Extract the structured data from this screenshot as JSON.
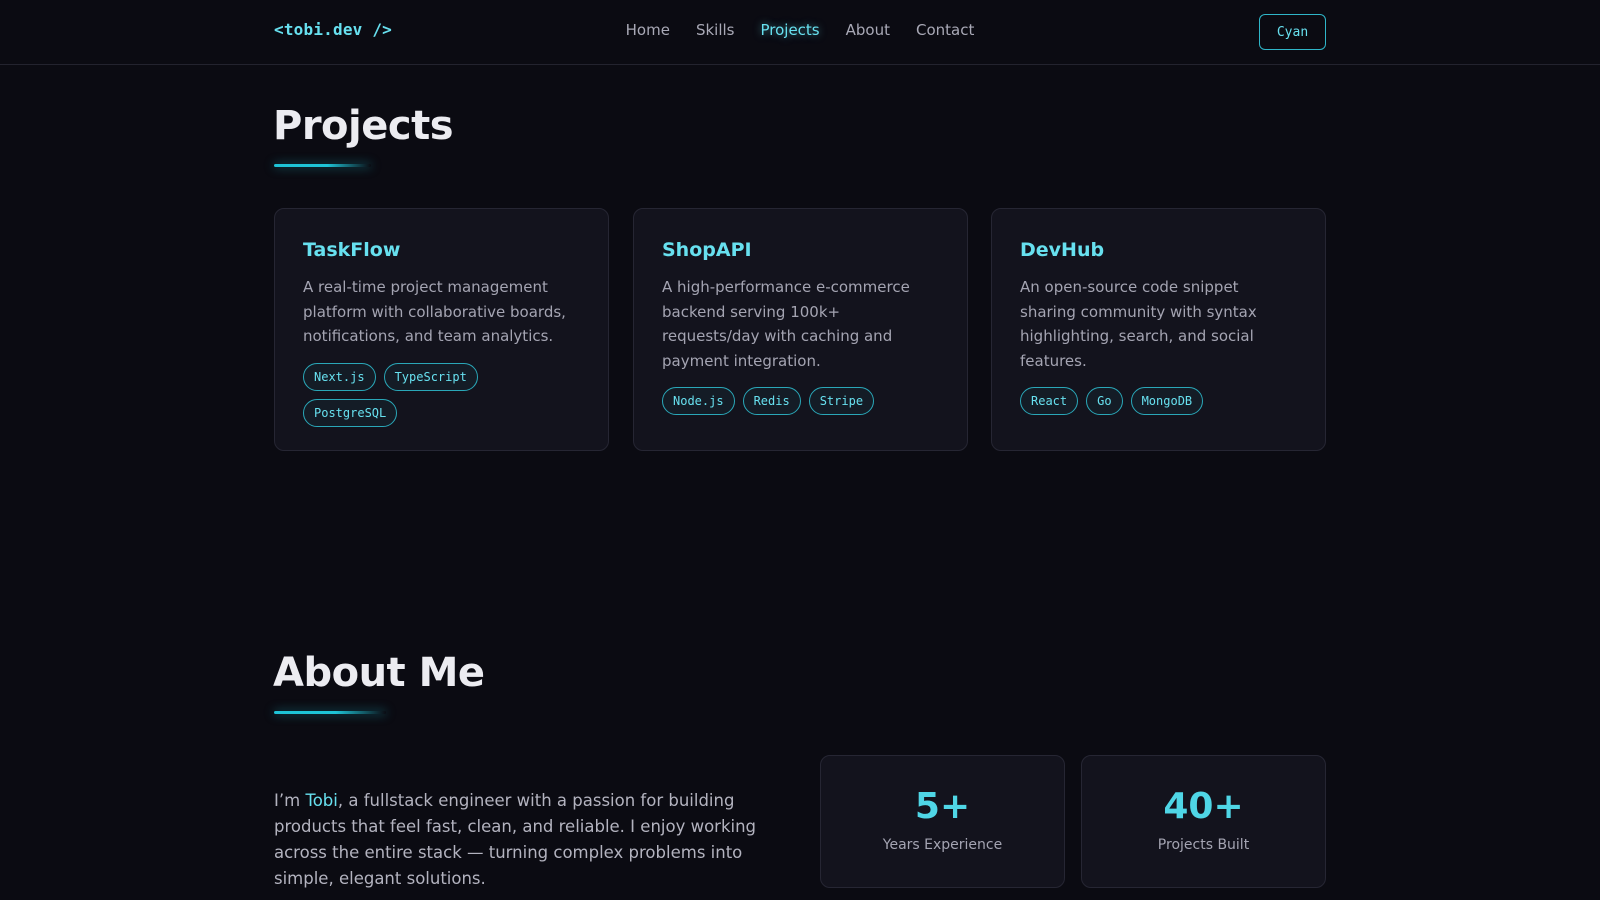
{
  "nav": {
    "logo": "<tobi.dev />",
    "links": [
      "Home",
      "Skills",
      "Projects",
      "About",
      "Contact"
    ],
    "active": "Projects",
    "theme_button": "Cyan"
  },
  "projects": {
    "title": "Projects",
    "cards": [
      {
        "title": "TaskFlow",
        "description": "A real-time project management platform with collaborative boards, notifications, and team analytics.",
        "tags": [
          "Next.js",
          "TypeScript",
          "PostgreSQL"
        ]
      },
      {
        "title": "ShopAPI",
        "description": "A high-performance e-commerce backend serving 100k+ requests/day with caching and payment integration.",
        "tags": [
          "Node.js",
          "Redis",
          "Stripe"
        ]
      },
      {
        "title": "DevHub",
        "description": "An open-source code snippet sharing community with syntax highlighting, search, and social features.",
        "tags": [
          "React",
          "Go",
          "MongoDB"
        ]
      }
    ]
  },
  "about": {
    "title": "About Me",
    "intro_prefix": "I’m ",
    "name": "Tobi",
    "intro_rest": ", a fullstack engineer with a passion for building products that feel fast, clean, and reliable. I enjoy working across the entire stack — turning complex problems into simple, elegant solutions.",
    "stats": [
      {
        "value": "5+",
        "label": "Years Experience"
      },
      {
        "value": "40+",
        "label": "Projects Built"
      }
    ]
  },
  "colors": {
    "accent": "#67e0ef",
    "background": "#0b0b12",
    "card": "#13131d"
  }
}
